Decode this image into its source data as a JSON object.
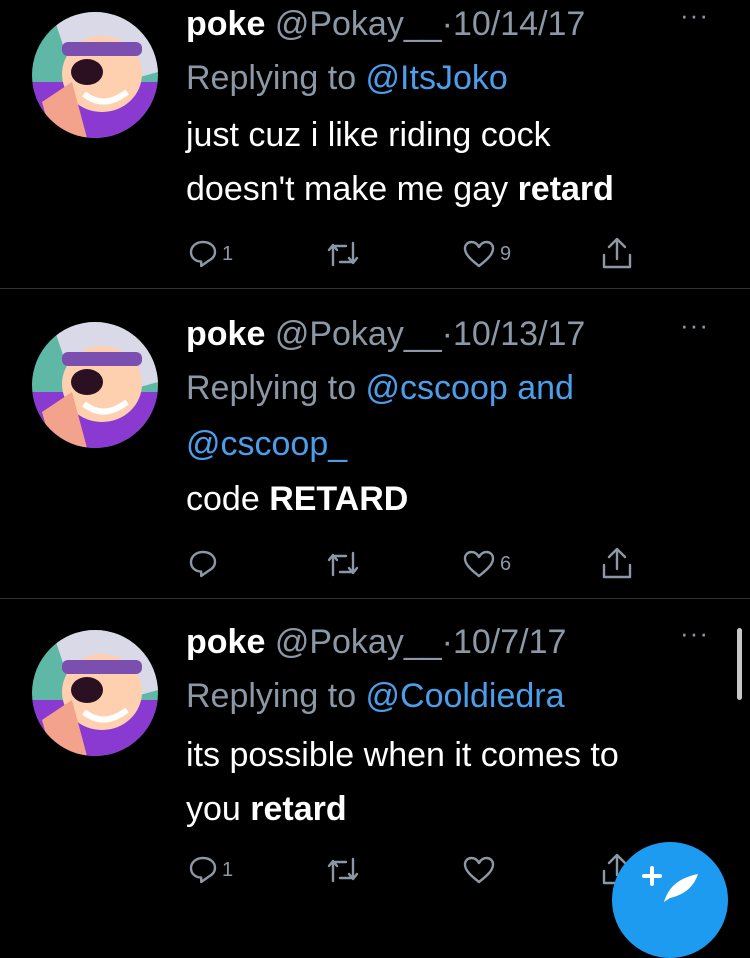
{
  "colors": {
    "background": "#000000",
    "text": "#ffffff",
    "secondary": "#8b98a5",
    "mention": "#4c9eeb",
    "divider": "#2f3336",
    "fab": "#1d9bf0"
  },
  "tweets": [
    {
      "name": "poke",
      "handle": "@Pokay__",
      "separator": "·",
      "date": "10/14/17",
      "reply_prefix": "Replying to ",
      "mentions": [
        "@ItsJoko"
      ],
      "mention_joiner": "",
      "text_lines": [
        {
          "plain": "just cuz i like riding cock",
          "bold": ""
        },
        {
          "plain": "doesn't make me gay ",
          "bold": "retard"
        }
      ],
      "reply_count": "1",
      "retweet_count": "",
      "like_count": "9",
      "avatar_icon": "user-avatar"
    },
    {
      "name": "poke",
      "handle": "@Pokay__",
      "separator": "·",
      "date": "10/13/17",
      "reply_prefix": "Replying to ",
      "mentions": [
        "@cscoop and",
        "@cscoop_"
      ],
      "mention_joiner": "",
      "text_lines": [
        {
          "plain": "code ",
          "bold": "RETARD"
        }
      ],
      "reply_count": "",
      "retweet_count": "",
      "like_count": "6",
      "avatar_icon": "user-avatar"
    },
    {
      "name": "poke",
      "handle": "@Pokay__",
      "separator": "·",
      "date": "10/7/17",
      "reply_prefix": "Replying to ",
      "mentions": [
        "@Cooldiedra"
      ],
      "mention_joiner": "",
      "text_lines": [
        {
          "plain": "its possible when it comes to",
          "bold": ""
        },
        {
          "plain": "you ",
          "bold": "retard"
        }
      ],
      "reply_count": "1",
      "retweet_count": "",
      "like_count": "",
      "avatar_icon": "user-avatar"
    }
  ],
  "icons": {
    "reply": "reply-icon",
    "retweet": "retweet-icon",
    "like": "heart-icon",
    "share": "share-icon",
    "more": "more-icon",
    "compose": "compose-tweet-icon"
  },
  "more_glyph": "···"
}
